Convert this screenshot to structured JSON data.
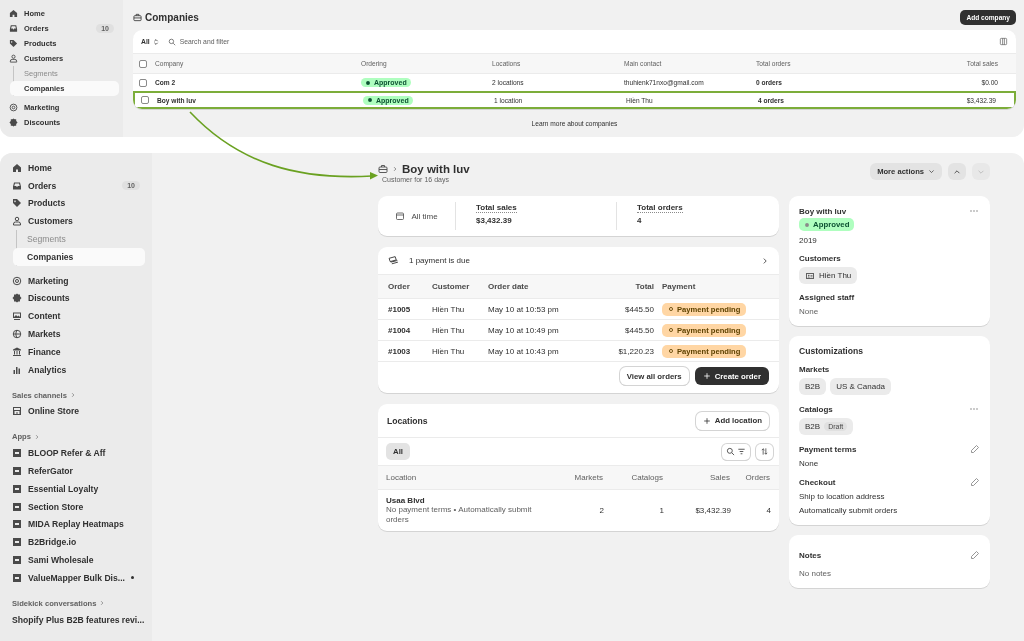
{
  "top_view": {
    "sidebar": {
      "sections": [
        {
          "items": [
            {
              "label": "Home",
              "selected": false
            },
            {
              "label": "Orders",
              "badge": "10",
              "selected": false
            },
            {
              "label": "Products",
              "selected": false
            },
            {
              "label": "Customers",
              "selected": false,
              "children": [
                {
                  "label": "Segments",
                  "selected": false
                },
                {
                  "label": "Companies",
                  "selected": true
                }
              ]
            }
          ]
        },
        {
          "items": [
            {
              "label": "Marketing",
              "selected": false
            },
            {
              "label": "Discounts",
              "selected": false
            }
          ]
        }
      ]
    },
    "page_title": "Companies",
    "add_button": "Add company",
    "filter": {
      "label": "All",
      "placeholder": "Search and filter"
    },
    "table": {
      "select_all_checked": false,
      "columns": [
        "Company",
        "Ordering",
        "Locations",
        "Main contact",
        "Total orders",
        "Total sales"
      ],
      "rows": [
        {
          "company": "Com 2",
          "ordering": "Approved",
          "locations": "2 locations",
          "contact": "thuhienk71nxo@gmail.com",
          "orders": "0 orders",
          "sales": "$0.00",
          "checked": false,
          "highlighted": false
        },
        {
          "company": "Boy with luv",
          "ordering": "Approved",
          "locations": "1 location",
          "contact": "Hiền Thu",
          "orders": "4 orders",
          "sales": "$3,432.39",
          "checked": false,
          "highlighted": true
        }
      ]
    },
    "footer_link": "Learn more about companies"
  },
  "detail_view": {
    "sidebar": {
      "sections": [
        {
          "items": [
            {
              "label": "Home",
              "selected": false
            },
            {
              "label": "Orders",
              "badge": "10",
              "selected": false
            },
            {
              "label": "Products",
              "selected": false
            },
            {
              "label": "Customers",
              "selected": false,
              "children": [
                {
                  "label": "Segments",
                  "selected": false
                },
                {
                  "label": "Companies",
                  "selected": true
                }
              ]
            }
          ]
        },
        {
          "items": [
            {
              "label": "Marketing",
              "selected": false
            },
            {
              "label": "Discounts",
              "selected": false
            },
            {
              "label": "Content",
              "selected": false
            },
            {
              "label": "Markets",
              "selected": false
            },
            {
              "label": "Finance",
              "selected": false
            },
            {
              "label": "Analytics",
              "selected": false
            }
          ]
        },
        {
          "title": "Sales channels",
          "items": [
            {
              "label": "Online Store",
              "selected": false
            }
          ]
        },
        {
          "title": "Apps",
          "items": [
            {
              "label": "BLOOP Refer & Aff",
              "selected": false
            },
            {
              "label": "ReferGator",
              "selected": false
            },
            {
              "label": "Essential Loyalty",
              "selected": false
            },
            {
              "label": "Section Store",
              "selected": false
            },
            {
              "label": "MIDA Replay Heatmaps",
              "selected": false
            },
            {
              "label": "B2Bridge.io",
              "selected": false
            },
            {
              "label": "Sami Wholesale",
              "selected": false
            },
            {
              "label": "ValueMapper Bulk Dis...",
              "dot": true,
              "selected": false
            }
          ]
        },
        {
          "title": "Sidekick conversations",
          "items": [
            {
              "label": "Shopify Plus B2B features revi...",
              "selected": false
            }
          ]
        }
      ]
    },
    "header": {
      "title": "Boy with luv",
      "subtitle": "Customer for 16 days",
      "more_actions": "More actions",
      "previous_disabled": false,
      "next_disabled": true
    },
    "stats": {
      "period": "All time",
      "metrics": [
        {
          "label": "Total sales",
          "value": "$3,432.39"
        },
        {
          "label": "Total orders",
          "value": "4"
        }
      ]
    },
    "orders": {
      "banner": "1 payment is due",
      "columns": [
        "Order",
        "Customer",
        "Order date",
        "Total",
        "Payment"
      ],
      "rows": [
        {
          "order": "#1005",
          "customer": "Hiền Thu",
          "date": "May 10 at 10:53 pm",
          "total": "$445.50",
          "payment": "Payment pending"
        },
        {
          "order": "#1004",
          "customer": "Hiền Thu",
          "date": "May 10 at 10:49 pm",
          "total": "$445.50",
          "payment": "Payment pending"
        },
        {
          "order": "#1003",
          "customer": "Hiền Thu",
          "date": "May 10 at 10:43 pm",
          "total": "$1,220.23",
          "payment": "Payment pending"
        }
      ],
      "buttons": [
        "View all orders",
        "Create order"
      ]
    },
    "locations": {
      "title": "Locations",
      "add_button": "Add location",
      "filter_tab": {
        "label": "All",
        "selected": true
      },
      "columns": [
        "Location",
        "Markets",
        "Catalogs",
        "Sales",
        "Orders"
      ],
      "rows": [
        {
          "name": "Usaa Blvd",
          "details": "No payment terms • Automatically submit orders",
          "markets": "2",
          "catalogs": "1",
          "sales": "$3,432.39",
          "orders": "4"
        }
      ]
    },
    "company_card": {
      "name": "Boy with luv",
      "status": "Approved",
      "year": "2019",
      "customers_label": "Customers",
      "customers": [
        "Hiền Thu"
      ],
      "staff_label": "Assigned staff",
      "staff": "None"
    },
    "customizations": {
      "title": "Customizations",
      "markets_label": "Markets",
      "markets": [
        "B2B",
        "US & Canada"
      ],
      "catalogs_label": "Catalogs",
      "catalogs": [
        {
          "name": "B2B",
          "status": "Draft"
        }
      ],
      "payment_terms_label": "Payment terms",
      "payment_terms": "None",
      "checkout_label": "Checkout",
      "checkout": [
        "Ship to location address",
        "Automatically submit orders"
      ]
    },
    "notes": {
      "title": "Notes",
      "text": "No notes"
    }
  }
}
